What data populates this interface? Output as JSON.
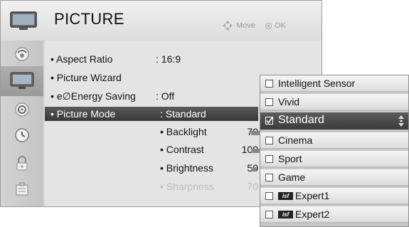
{
  "header": {
    "title": "PICTURE",
    "hint_move": "Move",
    "hint_ok": "OK",
    "icon": "tv-icon"
  },
  "sidebar": {
    "items": [
      {
        "icon": "satellite-dish-icon",
        "active": false
      },
      {
        "icon": "tv-screen-icon",
        "active": true
      },
      {
        "icon": "speaker-icon",
        "active": false
      },
      {
        "icon": "clock-icon",
        "active": false
      },
      {
        "icon": "lock-icon",
        "active": false
      },
      {
        "icon": "option-box-icon",
        "active": false
      }
    ]
  },
  "menu": {
    "items": [
      {
        "label": "• Aspect Ratio",
        "value": ": 16:9"
      },
      {
        "label": "• Picture Wizard",
        "value": ""
      },
      {
        "label": "• e∅Energy Saving",
        "value": ": Off"
      },
      {
        "label": "• Picture Mode",
        "value": ": Standard",
        "selected": true
      }
    ],
    "sub_items": [
      {
        "label": "• Backlight",
        "value": "70"
      },
      {
        "label": "• Contrast",
        "value": "100"
      },
      {
        "label": "• Brightness",
        "value": "50"
      },
      {
        "label": "• Sharpness",
        "value": "70",
        "disabled": true
      }
    ]
  },
  "dropdown": {
    "options": [
      {
        "label": "Intelligent Sensor",
        "checked": false
      },
      {
        "label": "Vivid",
        "checked": false
      },
      {
        "label": "Standard",
        "checked": true,
        "selected": true
      },
      {
        "label": "Cinema",
        "checked": false
      },
      {
        "label": "Sport",
        "checked": false
      },
      {
        "label": "Game",
        "checked": false
      },
      {
        "label": "Expert1",
        "badge": "isf",
        "checked": false
      },
      {
        "label": "Expert2",
        "badge": "isf",
        "checked": false
      }
    ]
  },
  "colors": {
    "selected_bg": "#3f3f3f",
    "panel_bg": "#e4e4e4",
    "header_bg": "#e8e8e8",
    "disabled_text": "#bcbcbc"
  }
}
